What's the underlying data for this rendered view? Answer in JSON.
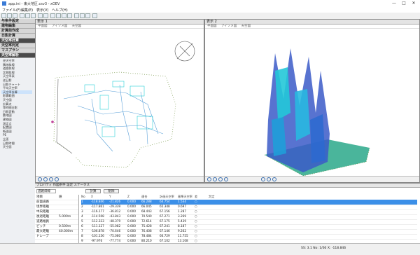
{
  "window": {
    "title": "app.ini - 東大地区.csv3 - xOEV",
    "controls": [
      "—",
      "□",
      "✕"
    ]
  },
  "menu": [
    "ファイル(F)",
    "編集(E)",
    "表示(V)",
    "ヘルプ(H)"
  ],
  "sidebar": {
    "sections": [
      {
        "label": "与条件設定",
        "style": "light"
      },
      {
        "label": "建物編集",
        "style": "light"
      },
      {
        "label": "計算前作成",
        "style": "light"
      },
      {
        "label": "日影計算",
        "style": "light"
      },
      {
        "label": "天空率計算",
        "style": "dark"
      },
      {
        "label": "天空率判定",
        "style": "light"
      },
      {
        "label": "マスプラン",
        "style": "light"
      },
      {
        "label": "天空率解析",
        "style": "dark"
      }
    ],
    "items": [
      "逆天空率",
      "隣地斜線",
      "道路斜線",
      "北側斜線",
      "天空率表",
      "逆日影",
      "日影チャート",
      "平均天空率",
      "天空率計算",
      "影響範囲",
      "天空図",
      "計算点",
      "等時間日影",
      "日影変動",
      "敷地図",
      "建物図",
      "測定点",
      "配置図",
      "断面図",
      "PE",
      "立面",
      "日影時間",
      "天空面"
    ],
    "selected_index": 8
  },
  "view_left": {
    "header": "表示 1",
    "tabs": [
      "平面図",
      "アイソメ図",
      "天空図"
    ]
  },
  "view_right": {
    "header": "表示 2",
    "tabs": [
      "平面図",
      "アイソメ図",
      "天空図"
    ]
  },
  "props": {
    "tabs": "プロパティ  作図条件  設定  ステータス",
    "filter_value": "道路斜線",
    "calc_button": "計算",
    "delete_button": "削除",
    "grid": [
      {
        "k": "項目",
        "v": "値"
      },
      {
        "k": "前面道路",
        "v": ""
      },
      {
        "k": "境界距離",
        "v": ""
      },
      {
        "k": "中央距離",
        "v": ""
      },
      {
        "k": "後退距離",
        "v": "5.000m"
      },
      {
        "k": "道路幅員",
        "v": ""
      },
      {
        "k": "ピッチ",
        "v": "0.500m"
      },
      {
        "k": "最大距離",
        "v": "40.000m"
      },
      {
        "k": "ドレープ",
        "v": ""
      }
    ],
    "table": {
      "headers": [
        "No",
        "X",
        "Y",
        "Z",
        "適合",
        "計画天空率",
        "基準天空率",
        "差",
        "判定"
      ],
      "rows": [
        [
          "1",
          "-118.846",
          "-21.826",
          "0.000",
          "66.288",
          "64.754",
          "1.534",
          "○"
        ],
        [
          "2",
          "-117.861",
          "-29.339",
          "0.000",
          "66.045",
          "65.348",
          "0.697",
          "○"
        ],
        [
          "3",
          "-116.177",
          "-36.812",
          "0.000",
          "68.443",
          "67.156",
          "1.287",
          "○"
        ],
        [
          "4",
          "-114.508",
          "-43.843",
          "0.000",
          "70.540",
          "67.271",
          "3.269",
          "○"
        ],
        [
          "5",
          "-112.333",
          "-48.379",
          "0.000",
          "72.614",
          "67.175",
          "5.439",
          "○"
        ],
        [
          "6",
          "-111.127",
          "-55.082",
          "0.000",
          "75.428",
          "67.241",
          "8.187",
          "○"
        ],
        [
          "7",
          "-106.878",
          "-70.646",
          "0.000",
          "76.408",
          "67.146",
          "9.262",
          "○"
        ],
        [
          "8",
          "-101.156",
          "-75.080",
          "0.000",
          "78.484",
          "66.729",
          "11.755",
          "○"
        ],
        [
          "9",
          "-97.976",
          "-77.774",
          "0.000",
          "80.210",
          "67.102",
          "13.108",
          "○"
        ]
      ]
    }
  },
  "status": {
    "left": "",
    "right": "SS: 3.1  No: 1/60  X: -118.846"
  }
}
